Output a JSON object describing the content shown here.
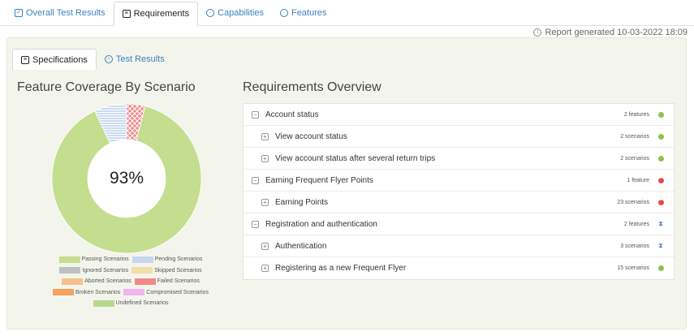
{
  "top_tabs": [
    {
      "label": "Overall Test Results",
      "icon": "checkbox-icon"
    },
    {
      "label": "Requirements",
      "icon": "document-icon"
    },
    {
      "label": "Capabilities",
      "icon": "comment-icon"
    },
    {
      "label": "Features",
      "icon": "comment-icon"
    }
  ],
  "report_generated": "Report generated 10-03-2022 18:09",
  "sub_tabs": [
    {
      "label": "Specifications",
      "icon": "document-icon"
    },
    {
      "label": "Test Results",
      "icon": "globe-icon"
    }
  ],
  "coverage": {
    "title": "Feature Coverage By Scenario",
    "percent_label": "93%",
    "segments": [
      {
        "name": "Passing Scenarios",
        "fraction": 0.89,
        "color": "#c4dd8f"
      },
      {
        "name": "Pending Scenarios",
        "fraction": 0.07,
        "color": "#c6d7ee"
      },
      {
        "name": "Failed Scenarios",
        "fraction": 0.04,
        "color": "#f08a8a"
      }
    ]
  },
  "legend": [
    [
      {
        "label": "Passing Scenarios",
        "color": "#c4dd8f"
      },
      {
        "label": "Pending Scenarios",
        "color": "#c6d7ee"
      }
    ],
    [
      {
        "label": "Ignored Scenarios",
        "color": "#bfbfbf"
      },
      {
        "label": "Skipped Scenarios",
        "color": "#f0e0a8"
      }
    ],
    [
      {
        "label": "Aborted Scenarios",
        "color": "#f5c08e"
      },
      {
        "label": "Failed Scenarios",
        "color": "#f08a8a"
      }
    ],
    [
      {
        "label": "Broken Scenarios",
        "color": "#f7a35c"
      },
      {
        "label": "Compromised Scenarios",
        "color": "#f2b3ee"
      }
    ],
    [
      {
        "label": "Undefined Scenarios",
        "color": "#b5d98c"
      }
    ]
  ],
  "requirements": {
    "title": "Requirements Overview",
    "rows": [
      {
        "name": "Account status",
        "count": "2 features",
        "status": "pass",
        "level": 0
      },
      {
        "name": "View account status",
        "count": "2 scenarios",
        "status": "pass",
        "level": 1
      },
      {
        "name": "View account status after several return trips",
        "count": "2 scenarios",
        "status": "pass",
        "level": 1
      },
      {
        "name": "Earning Frequent Flyer Points",
        "count": "1 feature",
        "status": "fail",
        "level": 0
      },
      {
        "name": "Earning Points",
        "count": "23 scenarios",
        "status": "fail",
        "level": 1
      },
      {
        "name": "Registration and authentication",
        "count": "2 features",
        "status": "pending",
        "level": 0
      },
      {
        "name": "Authentication",
        "count": "3 scenarios",
        "status": "pending",
        "level": 1
      },
      {
        "name": "Registering as a new Frequent Flyer",
        "count": "15 scenarios",
        "status": "pass",
        "level": 1
      }
    ]
  }
}
